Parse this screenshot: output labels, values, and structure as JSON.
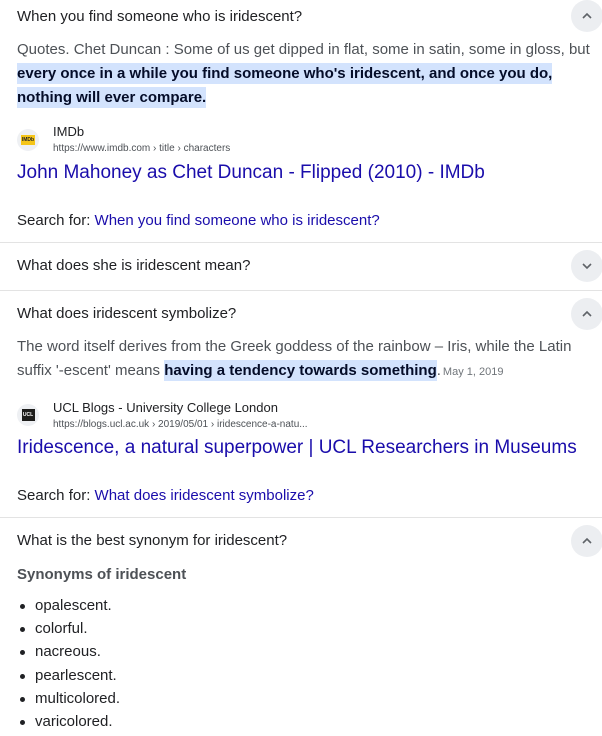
{
  "faq": [
    {
      "question": "When you find someone who is iridescent?",
      "expanded": true,
      "answer_plain": "Quotes. Chet Duncan : Some of us get dipped in flat, some in satin, some in gloss, but ",
      "answer_highlight": "every once in a while you find someone who's iridescent, and once you do, nothing will ever compare.",
      "source": {
        "name": "IMDb",
        "url": "https://www.imdb.com › title › characters",
        "icon": "imdb-logo",
        "icon_text": "IMDb",
        "icon_color": "#f5c518"
      },
      "result_title": "John Mahoney as Chet Duncan - Flipped (2010) - IMDb",
      "search_for_label": "Search for:",
      "search_for_link": "When you find someone who is iridescent?"
    },
    {
      "question": "What does she is iridescent mean?",
      "expanded": false
    },
    {
      "question": "What does iridescent symbolize?",
      "expanded": true,
      "answer_plain": "The word itself derives from the Greek goddess of the rainbow – Iris, while the Latin suffix '-escent' means ",
      "answer_highlight": "having a tendency towards something",
      "answer_end": ".",
      "date": "May 1, 2019",
      "source": {
        "name": "UCL Blogs - University College London",
        "url": "https://blogs.ucl.ac.uk › 2019/05/01 › iridescence-a-natu...",
        "icon": "ucl-logo",
        "icon_text": "UCL"
      },
      "result_title": "Iridescence, a natural superpower | UCL Researchers in Museums",
      "search_for_label": "Search for:",
      "search_for_link": "What does iridescent symbolize?"
    },
    {
      "question": "What is the best synonym for iridescent?",
      "expanded": true,
      "synonyms_heading": "Synonyms of iridescent",
      "synonyms": [
        "opalescent.",
        "colorful.",
        "nacreous.",
        "pearlescent.",
        "multicolored.",
        "varicolored."
      ]
    }
  ],
  "colors": {
    "link": "#1a0dab",
    "highlight": "#d3e3fd",
    "chevron_bg": "#eceef1"
  }
}
